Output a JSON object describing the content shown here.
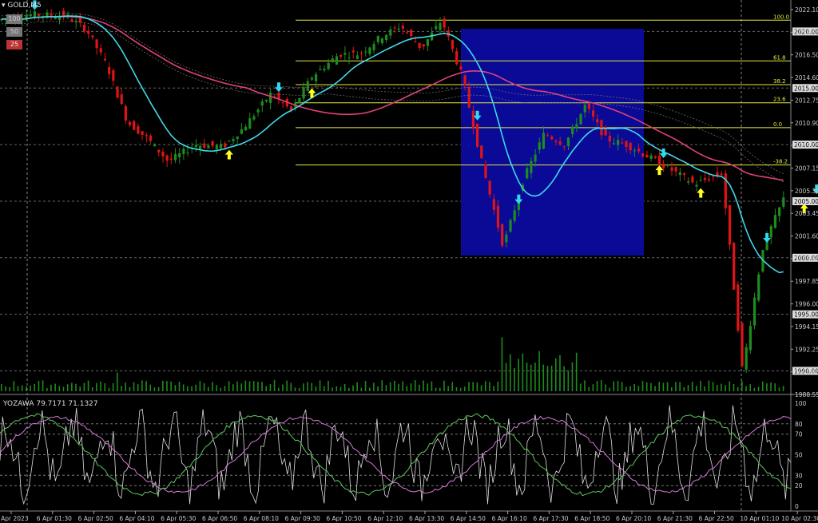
{
  "window": {
    "title": "GOLD,M5"
  },
  "quick_buttons": [
    "100",
    "50",
    "25"
  ],
  "price_axis": {
    "ticks": [
      "2022.10",
      "2018.35",
      "2016.50",
      "2014.60",
      "2012.75",
      "2010.90",
      "2009.05",
      "2007.15",
      "2005.30",
      "2003.45",
      "2001.60",
      "1999.70",
      "1997.85",
      "1996.00",
      "1994.15",
      "1992.25",
      "1990.40",
      "1988.55"
    ],
    "markers": [
      {
        "label": "2020.00",
        "price": 2020.0
      },
      {
        "label": "2015.00",
        "price": 2015.0
      },
      {
        "label": "2010.00",
        "price": 2010.0
      },
      {
        "label": "2005.00",
        "price": 2005.0
      },
      {
        "label": "2000.00",
        "price": 2000.0
      },
      {
        "label": "1995.00",
        "price": 1995.0
      },
      {
        "label": "1990.00",
        "price": 1990.0
      }
    ],
    "current_price": "2005.00"
  },
  "time_axis": {
    "labels": [
      "6 Apr 2023",
      "6 Apr 01:30",
      "6 Apr 02:50",
      "6 Apr 04:10",
      "6 Apr 05:30",
      "6 Apr 06:50",
      "6 Apr 08:10",
      "6 Apr 09:30",
      "6 Apr 10:50",
      "6 Apr 12:10",
      "6 Apr 13:30",
      "6 Apr 14:50",
      "6 Apr 16:10",
      "6 Apr 17:30",
      "6 Apr 18:50",
      "6 Apr 20:10",
      "6 Apr 21:30",
      "6 Apr 22:50",
      "10 Apr 01:10",
      "10 Apr 02:30"
    ]
  },
  "fibonacci": {
    "levels": [
      {
        "label": "100.0",
        "price": 2021.0
      },
      {
        "label": "61.8",
        "price": 2017.4
      },
      {
        "label": "38.2",
        "price": 2015.3
      },
      {
        "label": "23.6",
        "price": 2013.7
      },
      {
        "label": "0.0",
        "price": 2011.5
      },
      {
        "label": "-38.2",
        "price": 2008.2
      }
    ]
  },
  "indicator": {
    "title": "YOZAWA 79.7171 71.1327",
    "levels": [
      "100",
      "80",
      "70",
      "50",
      "30",
      "20",
      "0"
    ]
  },
  "colors": {
    "bull": "#1e8c1e",
    "bear": "#e01414",
    "ma_fast": "#40d8e8",
    "ma_slow": "#e0407a",
    "fib": "#e8e840",
    "highlight_box": "#0a0a96",
    "arrow_up": "#ffff20",
    "arrow_down": "#30d8f0",
    "grid": "#555"
  }
}
